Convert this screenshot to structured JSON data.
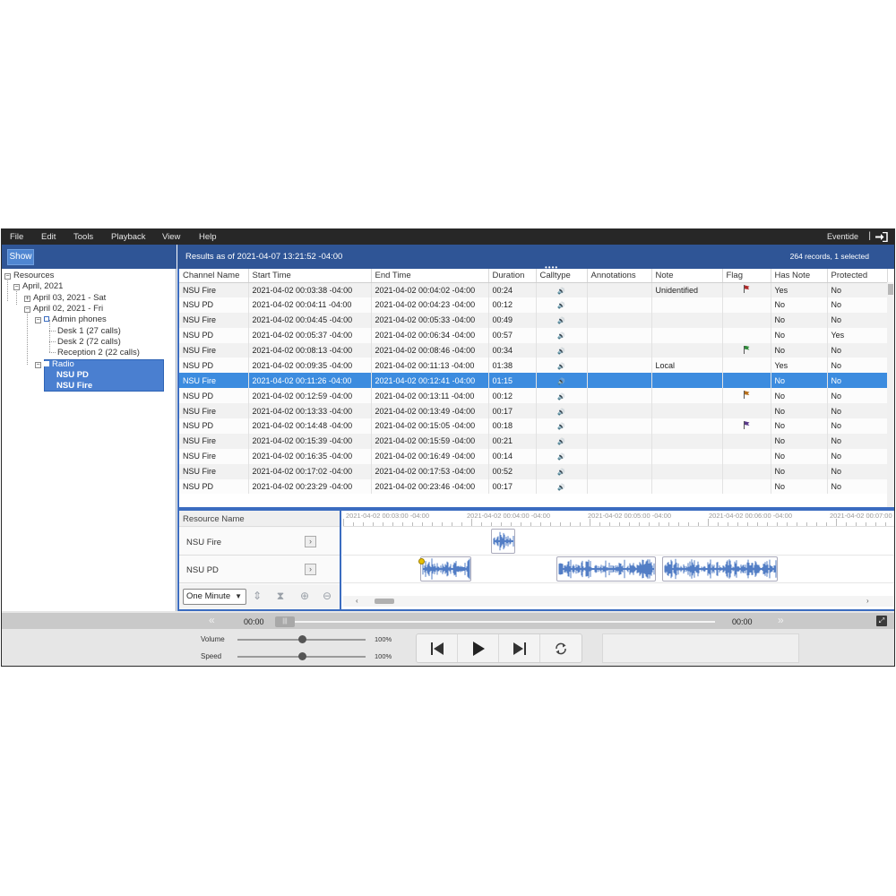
{
  "menubar": {
    "items": [
      "File",
      "Edit",
      "Tools",
      "Playback",
      "View",
      "Help"
    ],
    "brand": "Eventide",
    "separator": "|"
  },
  "left_panel": {
    "show_button": "Show",
    "tree": {
      "root": "Resources",
      "month": "April, 2021",
      "day1": "April 03, 2021 - Sat",
      "day2": "April 02, 2021 - Fri",
      "group1": "Admin phones",
      "desk1": "Desk 1 (27 calls)",
      "desk2": "Desk 2 (72 calls)",
      "reception": "Reception 2 (22 calls)",
      "group2": "Radio",
      "radio1": "NSU PD",
      "radio2": "NSU Fire"
    }
  },
  "results": {
    "header": "Results as of 2021-04-07 13:21:52 -04:00",
    "records": "264 records, 1 selected"
  },
  "table": {
    "columns": [
      "Channel Name",
      "Start Time",
      "End Time",
      "Duration",
      "Calltype",
      "Annotations",
      "Note",
      "Flag",
      "Has Note",
      "Protected"
    ],
    "rows": [
      {
        "channel": "NSU Fire",
        "start": "2021-04-02 00:03:38 -04:00",
        "end": "2021-04-02 00:04:02 -04:00",
        "duration": "00:24",
        "note": "Unidentified",
        "flag": "red",
        "has_note": "Yes",
        "protected": "No"
      },
      {
        "channel": "NSU PD",
        "start": "2021-04-02 00:04:11 -04:00",
        "end": "2021-04-02 00:04:23 -04:00",
        "duration": "00:12",
        "note": "",
        "flag": "",
        "has_note": "No",
        "protected": "No"
      },
      {
        "channel": "NSU Fire",
        "start": "2021-04-02 00:04:45 -04:00",
        "end": "2021-04-02 00:05:33 -04:00",
        "duration": "00:49",
        "note": "",
        "flag": "",
        "has_note": "No",
        "protected": "No"
      },
      {
        "channel": "NSU PD",
        "start": "2021-04-02 00:05:37 -04:00",
        "end": "2021-04-02 00:06:34 -04:00",
        "duration": "00:57",
        "note": "",
        "flag": "",
        "has_note": "No",
        "protected": "Yes"
      },
      {
        "channel": "NSU Fire",
        "start": "2021-04-02 00:08:13 -04:00",
        "end": "2021-04-02 00:08:46 -04:00",
        "duration": "00:34",
        "note": "",
        "flag": "green",
        "has_note": "No",
        "protected": "No"
      },
      {
        "channel": "NSU PD",
        "start": "2021-04-02 00:09:35 -04:00",
        "end": "2021-04-02 00:11:13 -04:00",
        "duration": "01:38",
        "note": "Local",
        "flag": "",
        "has_note": "Yes",
        "protected": "No"
      },
      {
        "channel": "NSU Fire",
        "start": "2021-04-02 00:11:26 -04:00",
        "end": "2021-04-02 00:12:41 -04:00",
        "duration": "01:15",
        "note": "",
        "flag": "",
        "has_note": "No",
        "protected": "No",
        "selected": true
      },
      {
        "channel": "NSU PD",
        "start": "2021-04-02 00:12:59 -04:00",
        "end": "2021-04-02 00:13:11 -04:00",
        "duration": "00:12",
        "note": "",
        "flag": "orange",
        "has_note": "No",
        "protected": "No"
      },
      {
        "channel": "NSU Fire",
        "start": "2021-04-02 00:13:33 -04:00",
        "end": "2021-04-02 00:13:49 -04:00",
        "duration": "00:17",
        "note": "",
        "flag": "",
        "has_note": "No",
        "protected": "No"
      },
      {
        "channel": "NSU PD",
        "start": "2021-04-02 00:14:48 -04:00",
        "end": "2021-04-02 00:15:05 -04:00",
        "duration": "00:18",
        "note": "",
        "flag": "purple",
        "has_note": "No",
        "protected": "No"
      },
      {
        "channel": "NSU Fire",
        "start": "2021-04-02 00:15:39 -04:00",
        "end": "2021-04-02 00:15:59 -04:00",
        "duration": "00:21",
        "note": "",
        "flag": "",
        "has_note": "No",
        "protected": "No"
      },
      {
        "channel": "NSU Fire",
        "start": "2021-04-02 00:16:35 -04:00",
        "end": "2021-04-02 00:16:49 -04:00",
        "duration": "00:14",
        "note": "",
        "flag": "",
        "has_note": "No",
        "protected": "No"
      },
      {
        "channel": "NSU Fire",
        "start": "2021-04-02 00:17:02 -04:00",
        "end": "2021-04-02 00:17:53 -04:00",
        "duration": "00:52",
        "note": "",
        "flag": "",
        "has_note": "No",
        "protected": "No"
      },
      {
        "channel": "NSU PD",
        "start": "2021-04-02 00:23:29 -04:00",
        "end": "2021-04-02 00:23:46 -04:00",
        "duration": "00:17",
        "note": "",
        "flag": "",
        "has_note": "No",
        "protected": "No"
      }
    ],
    "flag_colors": {
      "red": "#b02a2a",
      "green": "#2f8a3a",
      "orange": "#b8701c",
      "purple": "#5a3a8a"
    }
  },
  "timeline": {
    "resource_header": "Resource Name",
    "resources": [
      "NSU Fire",
      "NSU PD"
    ],
    "zoom": "One Minute",
    "ticks": [
      "2021-04-02 00:03:00 -04:00",
      "2021-04-02 00:04:00 -04:00",
      "2021-04-02 00:05:00 -04:00",
      "2021-04-02 00:06:00 -04:00",
      "2021-04-02 00:07:00 -04:00"
    ]
  },
  "player": {
    "time_start": "00:00",
    "time_end": "00:00",
    "volume_label": "Volume",
    "volume_value": "100%",
    "volume_level": 0.5,
    "speed_label": "Speed",
    "speed_value": "100%",
    "speed_level": 0.5
  },
  "colors": {
    "header_blue": "#2f5596",
    "selection_blue": "#3c8cdf",
    "waveform": "#3f6fbf"
  }
}
